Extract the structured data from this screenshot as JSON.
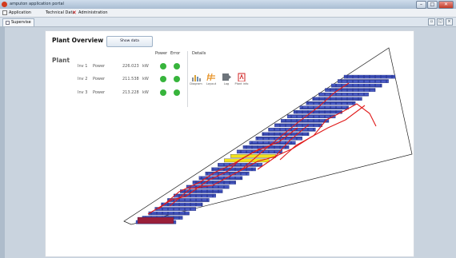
{
  "window": {
    "title": "amputon application portal"
  },
  "menu": {
    "items": [
      {
        "label": "Application"
      },
      {
        "label": "Technical Data"
      },
      {
        "label": "Administration"
      }
    ]
  },
  "tab": {
    "label": "Supervise"
  },
  "panel": {
    "title": "Plant Overview",
    "show_data_button": "Show data",
    "plant_label": "Plant",
    "headers": {
      "power": "Power",
      "error": "Error",
      "details": "Details"
    },
    "inverters": [
      {
        "name": "Inv 1",
        "power_label": "Power",
        "value": "226.023",
        "unit": "kW",
        "power_ok": true,
        "error_ok": true
      },
      {
        "name": "Inv 2",
        "power_label": "Power",
        "value": "211.538",
        "unit": "kW",
        "power_ok": true,
        "error_ok": true
      },
      {
        "name": "Inv 3",
        "power_label": "Power",
        "value": "213.228",
        "unit": "kW",
        "power_ok": true,
        "error_ok": true
      }
    ],
    "details": [
      {
        "label": "Diagram",
        "icon": "bar-chart-icon"
      },
      {
        "label": "Layout",
        "icon": "layout-icon"
      },
      {
        "label": "Log",
        "icon": "log-icon"
      },
      {
        "label": "Plant info",
        "icon": "pdf-icon"
      }
    ]
  },
  "colors": {
    "ok": "#37b43c",
    "module": "#2b3a9b",
    "string_line": "#e01a1a",
    "highlight": "#f2e21a"
  }
}
